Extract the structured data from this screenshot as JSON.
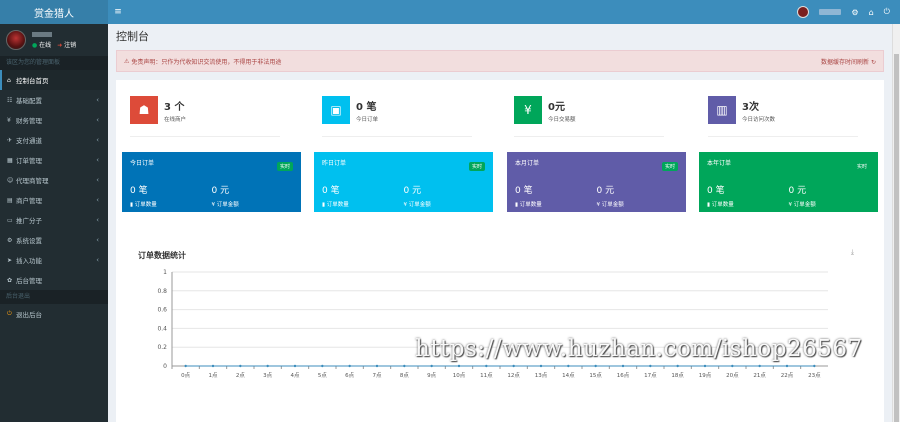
{
  "app": {
    "title": "赏金猎人"
  },
  "topbar": {
    "toggle": "≡",
    "icons": [
      "gear-icon",
      "home-icon",
      "power-icon"
    ]
  },
  "sidebar": {
    "user": {
      "online": "在线",
      "logout": "注销"
    },
    "section1": "该区为您的管理面板",
    "items": [
      {
        "label": "控制台首页",
        "icon": "⌂",
        "active": true,
        "chevron": ""
      },
      {
        "label": "基础配置",
        "icon": "☷",
        "chevron": "‹"
      },
      {
        "label": "财务管理",
        "icon": "¥",
        "chevron": "‹"
      },
      {
        "label": "支付通道",
        "icon": "✈",
        "chevron": "‹"
      },
      {
        "label": "订单管理",
        "icon": "▦",
        "chevron": "‹"
      },
      {
        "label": "代理商管理",
        "icon": "☺",
        "chevron": "‹"
      },
      {
        "label": "商户管理",
        "icon": "▤",
        "chevron": "‹"
      },
      {
        "label": "推广分子",
        "icon": "▭",
        "chevron": "‹"
      },
      {
        "label": "系统设置",
        "icon": "⚙",
        "chevron": "‹"
      },
      {
        "label": "插入功能",
        "icon": "➤",
        "chevron": "‹"
      },
      {
        "label": "后台管理",
        "icon": "✿",
        "chevron": ""
      }
    ],
    "section2": "后台退出",
    "logout_item": "退出后台"
  },
  "content": {
    "title": "控制台"
  },
  "alert": {
    "text": "免责声明：只作为代收知识交流使用，不得用于非法用途",
    "right": "数据缓存时间刷新"
  },
  "stats": [
    {
      "value": "3 个",
      "label": "在线商户",
      "color": "#dd4b39",
      "icon": "☗"
    },
    {
      "value": "0 笔",
      "label": "今日订单",
      "color": "#00c0ef",
      "icon": "▣"
    },
    {
      "value": "0元",
      "label": "今日交易额",
      "color": "#00a65a",
      "icon": "¥"
    },
    {
      "value": "3次",
      "label": "今日访问次数",
      "color": "#605ca8",
      "icon": "▥"
    }
  ],
  "cards": [
    {
      "title": "今日订单",
      "badge": "实时",
      "v1": "0 笔",
      "v2": "0 元",
      "l1": "订单数量",
      "l2": "订单金额",
      "color": "#0073b7"
    },
    {
      "title": "昨日订单",
      "badge": "实时",
      "v1": "0 笔",
      "v2": "0 元",
      "l1": "订单数量",
      "l2": "订单金额",
      "color": "#00c0ef"
    },
    {
      "title": "本月订单",
      "badge": "实时",
      "v1": "0 笔",
      "v2": "0 元",
      "l1": "订单数量",
      "l2": "订单金额",
      "color": "#605ca8"
    },
    {
      "title": "本年订单",
      "badge": "实时",
      "v1": "0 笔",
      "v2": "0 元",
      "l1": "订单数量",
      "l2": "订单金额",
      "color": "#00a65a"
    }
  ],
  "chart_title": "订单数据统计",
  "chart_data": {
    "type": "line",
    "title": "订单数据统计",
    "categories": [
      "0点",
      "1点",
      "2点",
      "3点",
      "4点",
      "5点",
      "6点",
      "7点",
      "8点",
      "9点",
      "10点",
      "11点",
      "12点",
      "13点",
      "14点",
      "15点",
      "16点",
      "17点",
      "18点",
      "19点",
      "20点",
      "21点",
      "22点",
      "23点"
    ],
    "series": [
      {
        "values": [
          0,
          0,
          0,
          0,
          0,
          0,
          0,
          0,
          0,
          0,
          0,
          0,
          0,
          0,
          0,
          0,
          0,
          0,
          0,
          0,
          0,
          0,
          0,
          0
        ]
      }
    ],
    "yticks": [
      "0",
      "0.2",
      "0.4",
      "0.6",
      "0.8",
      "1"
    ],
    "ylim": [
      0,
      1
    ],
    "grid": true
  },
  "watermark": "https://www.huzhan.com/ishop26567"
}
